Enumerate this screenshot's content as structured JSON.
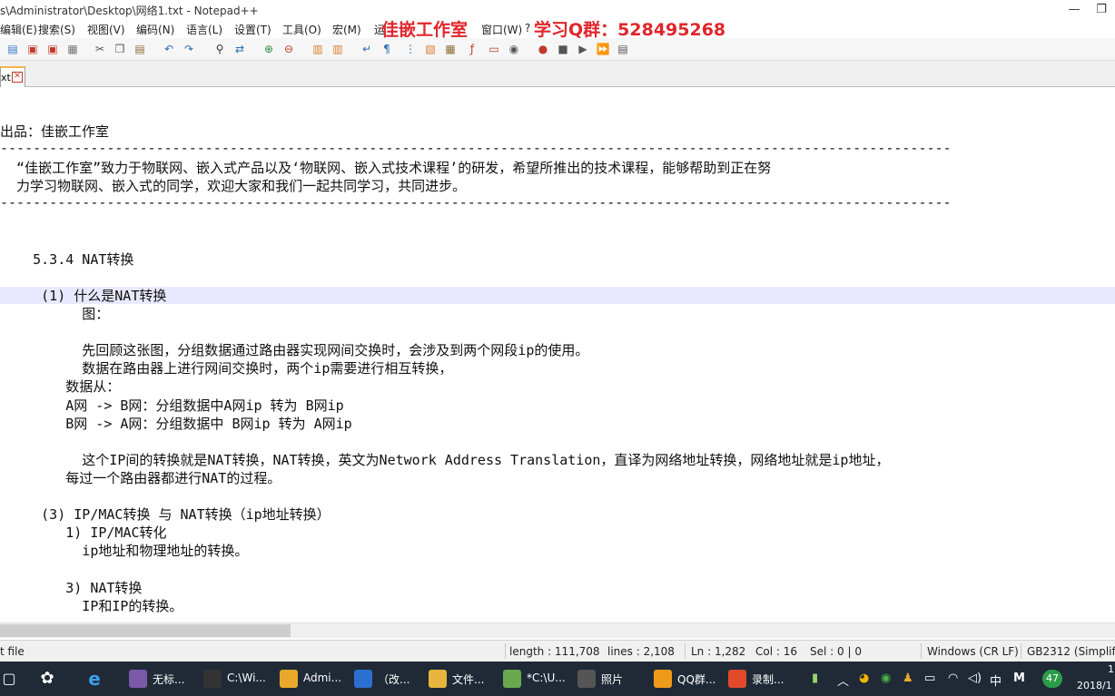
{
  "window": {
    "title": "s\\Administrator\\Desktop\\网络1.txt - Notepad++",
    "minimize": "—",
    "restore": "❐"
  },
  "watermark": {
    "studio": "佳嵌工作室",
    "qq_group": "学习Q群：528495268"
  },
  "menu": {
    "items": [
      "编辑(E)",
      "搜索(S)",
      "视图(V)",
      "编码(N)",
      "语言(L)",
      "设置(T)",
      "工具(O)",
      "宏(M)",
      "运",
      "窗口(W)",
      "?"
    ]
  },
  "tab": {
    "label": "xt",
    "close": "✕"
  },
  "editor": {
    "lines": [
      {
        "text": "出品：佳嵌工作室",
        "indent": 0
      },
      {
        "text": "--------------------------------------------------------------------------------------------------------------------",
        "indent": 0
      },
      {
        "text": "  “佳嵌工作室”致力于物联网、嵌入式产品以及‘物联网、嵌入式技术课程’的研发，希望所推出的技术课程，能够帮助到正在努",
        "indent": 0
      },
      {
        "text": "  力学习物联网、嵌入式的同学，欢迎大家和我们一起共同学习，共同进步。",
        "indent": 0
      },
      {
        "text": "--------------------------------------------------------------------------------------------------------------------",
        "indent": 0
      },
      {
        "text": "",
        "indent": 0
      },
      {
        "text": "",
        "indent": 0
      },
      {
        "text": "    5.3.4 NAT转换",
        "indent": 0
      },
      {
        "text": "",
        "indent": 0
      },
      {
        "text": "     (1) 什么是NAT转换",
        "indent": 0
      },
      {
        "text": "          图：",
        "indent": 0
      },
      {
        "text": "",
        "indent": 0
      },
      {
        "text": "          先回顾这张图，分组数据通过路由器实现网间交换时，会涉及到两个网段ip的使用。",
        "indent": 0
      },
      {
        "text": "          数据在路由器上进行网间交换时，两个ip需要进行相互转换，",
        "indent": 0
      },
      {
        "text": "        数据从：",
        "indent": 0
      },
      {
        "text": "        A网 -> B网：分组数据中A网ip 转为 B网ip",
        "indent": 0
      },
      {
        "text": "        B网 -> A网：分组数据中 B网ip 转为 A网ip",
        "indent": 0
      },
      {
        "text": "",
        "indent": 0
      },
      {
        "text": "          这个IP间的转换就是NAT转换，NAT转换，英文为Network Address Translation，直译为网络地址转换，网络地址就是ip地址，",
        "indent": 0
      },
      {
        "text": "        每过一个路由器都进行NAT的过程。",
        "indent": 0
      },
      {
        "text": "",
        "indent": 0
      },
      {
        "text": "     (3) IP/MAC转换 与 NAT转换（ip地址转换）",
        "indent": 0
      },
      {
        "text": "        1) IP/MAC转化",
        "indent": 0
      },
      {
        "text": "          ip地址和物理地址的转换。",
        "indent": 0
      },
      {
        "text": "",
        "indent": 0
      },
      {
        "text": "        3) NAT转换",
        "indent": 0
      },
      {
        "text": "          IP和IP的转换。",
        "indent": 0
      }
    ]
  },
  "status": {
    "file_type": "t file",
    "length": "length : 111,708",
    "lines": "lines : 2,108",
    "ln": "Ln : 1,282",
    "col": "Col : 16",
    "sel": "Sel : 0 | 0",
    "eol": "Windows (CR LF)",
    "encoding": "GB2312 (Simplifie"
  },
  "taskbar": {
    "apps": [
      {
        "label": "无标...",
        "icon": "paint-icon",
        "color": "#7a5aa8"
      },
      {
        "label": "C:\\Wi...",
        "icon": "cmd-icon",
        "color": "#333333"
      },
      {
        "label": "Admi...",
        "icon": "qq-user-icon",
        "color": "#e9a82a"
      },
      {
        "label": "（改...",
        "icon": "word-icon",
        "color": "#2b6fd1"
      },
      {
        "label": "文件...",
        "icon": "folder-icon",
        "color": "#e7b53d"
      },
      {
        "label": "*C:\\U...",
        "icon": "notepadpp-icon",
        "color": "#6aa84f"
      },
      {
        "label": "照片",
        "icon": "photos-icon",
        "color": "#555555"
      },
      {
        "label": "QQ群...",
        "icon": "qq-group-icon",
        "color": "#f09a1a"
      },
      {
        "label": "录制...",
        "icon": "recorder-icon",
        "color": "#e04a2b"
      }
    ],
    "tray": {
      "ime": "中",
      "ime2": "M",
      "badge": "47",
      "clock_time": "1",
      "clock_date": "2018/1"
    }
  }
}
